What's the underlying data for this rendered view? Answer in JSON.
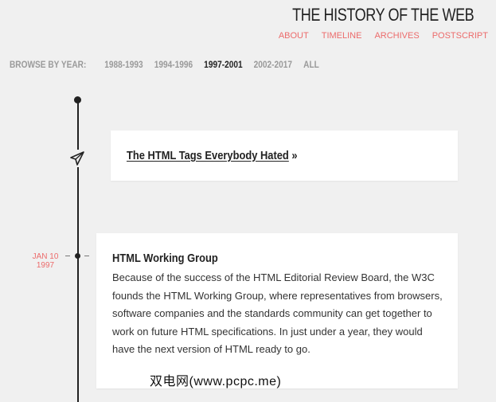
{
  "header": {
    "site_title": "THE HISTORY OF THE WEB",
    "nav": [
      "ABOUT",
      "TIMELINE",
      "ARCHIVES",
      "POSTSCRIPT"
    ]
  },
  "browse": {
    "label": "BROWSE BY YEAR:",
    "years": [
      "1988-1993",
      "1994-1996",
      "1997-2001",
      "2002-2017",
      "ALL"
    ],
    "active": "1997-2001"
  },
  "entries": [
    {
      "link_text": "The HTML Tags Everybody Hated",
      "arrow": "»",
      "icon": "paper-plane-icon"
    },
    {
      "date_month_day": "JAN 10",
      "date_year": "1997",
      "title": "HTML Working Group",
      "body": "Because of the success of the HTML Editorial Review Board, the W3C founds the HTML Working Group, where representatives from browsers, software companies and the standards community can get together to work on future HTML specifications. In just under a year, they would have the next version of HTML ready to go."
    }
  ],
  "watermark": "双电网(www.pcpc.me)",
  "colors": {
    "accent": "#ec6b6b",
    "text": "#222222",
    "background": "#f0f0f0"
  }
}
